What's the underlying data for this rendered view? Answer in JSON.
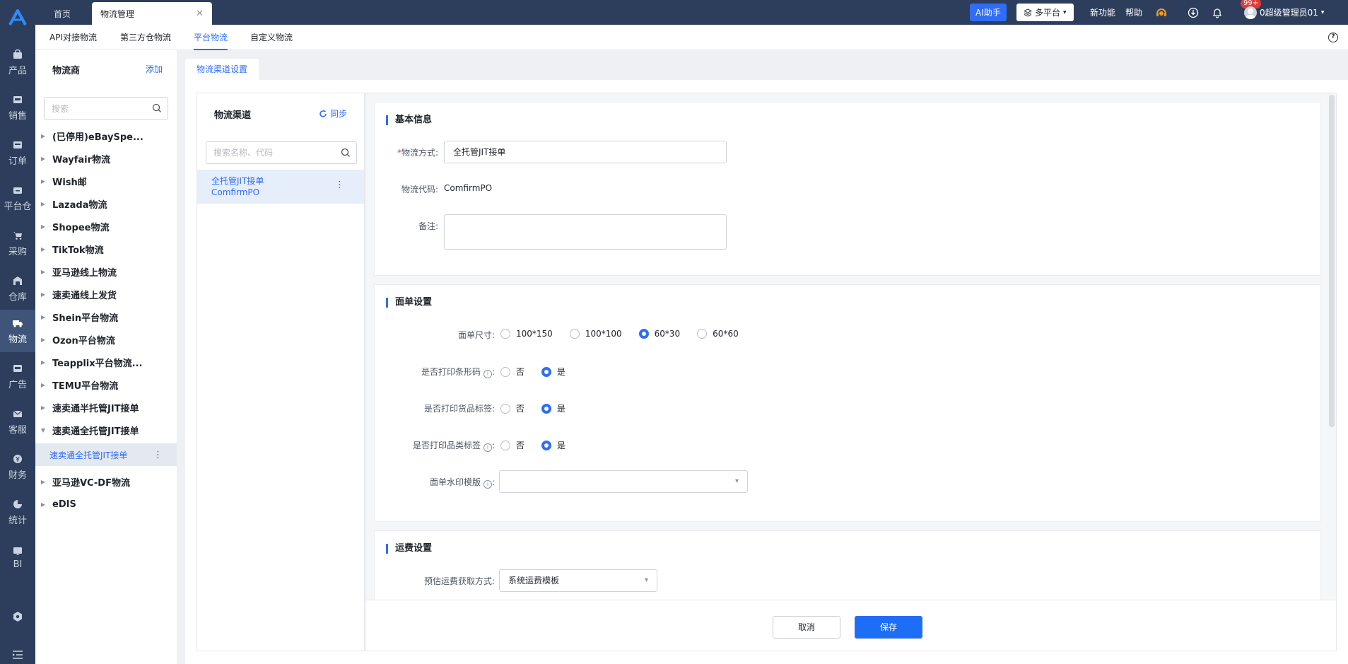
{
  "colors": {
    "accent": "#2f6df6",
    "rail_bg": "#2c3e5b",
    "active_rail": "#3e5479",
    "danger": "#e53935"
  },
  "rail": {
    "items": [
      {
        "label": "产品",
        "icon": "bag-icon"
      },
      {
        "label": "销售",
        "icon": "sell-tag-icon"
      },
      {
        "label": "订单",
        "icon": "order-icon"
      },
      {
        "label": "平台仓",
        "icon": "warehouse-icon"
      },
      {
        "label": "采购",
        "icon": "cart-icon"
      },
      {
        "label": "仓库",
        "icon": "storage-icon"
      },
      {
        "label": "物流",
        "icon": "truck-icon"
      },
      {
        "label": "广告",
        "icon": "ad-icon"
      },
      {
        "label": "客服",
        "icon": "mail-icon"
      },
      {
        "label": "财务",
        "icon": "yen-icon"
      },
      {
        "label": "统计",
        "icon": "pie-chart-icon"
      },
      {
        "label": "BI",
        "icon": "bi-chart-icon"
      }
    ]
  },
  "header": {
    "tabs": [
      {
        "label": "首页"
      },
      {
        "label": "物流管理"
      }
    ],
    "ai_label": "AI助手",
    "platform_label": "多平台",
    "new_features": "新功能",
    "help": "帮助",
    "notifications": "99+",
    "user": "0超级管理员01"
  },
  "subnav": {
    "items": [
      {
        "label": "API对接物流"
      },
      {
        "label": "第三方仓物流"
      },
      {
        "label": "平台物流"
      },
      {
        "label": "自定义物流"
      }
    ]
  },
  "carrier": {
    "title": "物流商",
    "add": "添加",
    "search_placeholder": "搜索",
    "items": [
      "(已停用)eBaySpe...",
      "Wayfair物流",
      "Wish邮",
      "Lazada物流",
      "Shopee物流",
      "TikTok物流",
      "亚马逊线上物流",
      "速卖通线上发货",
      "Shein平台物流",
      "Ozon平台物流",
      "Teapplix平台物流...",
      "TEMU平台物流",
      "速卖通半托管JIT接单",
      "速卖通全托管JIT接单",
      "亚马逊VC-DF物流",
      "eDIS"
    ],
    "selected_child": "速卖通全托管JIT接单"
  },
  "main": {
    "section_tab": "物流渠道设置",
    "channel": {
      "title": "物流渠道",
      "sync": "同步",
      "search_placeholder": "搜索名称、代码",
      "item_name": "全托管JIT接单",
      "item_code": "ComfirmPO"
    },
    "basic": {
      "title": "基本信息",
      "method_label": "物流方式:",
      "method_value": "全托管JIT接单",
      "code_label": "物流代码:",
      "code_value": "ComfirmPO",
      "remark_label": "备注:"
    },
    "label_settings": {
      "title": "面单设置",
      "size_label": "面单尺寸:",
      "sizes": [
        "100*150",
        "100*100",
        "60*30",
        "60*60"
      ],
      "barcode_label": "是否打印条形码",
      "goods_label": "是否打印货品标签:",
      "category_label": "是否打印品类标签",
      "no": "否",
      "yes": "是",
      "watermark_label": "面单水印模版"
    },
    "freight": {
      "title": "运费设置",
      "estimate_label": "预估运费获取方式:",
      "estimate_value": "系统运费模板"
    },
    "footer": {
      "cancel": "取消",
      "save": "保存"
    }
  }
}
